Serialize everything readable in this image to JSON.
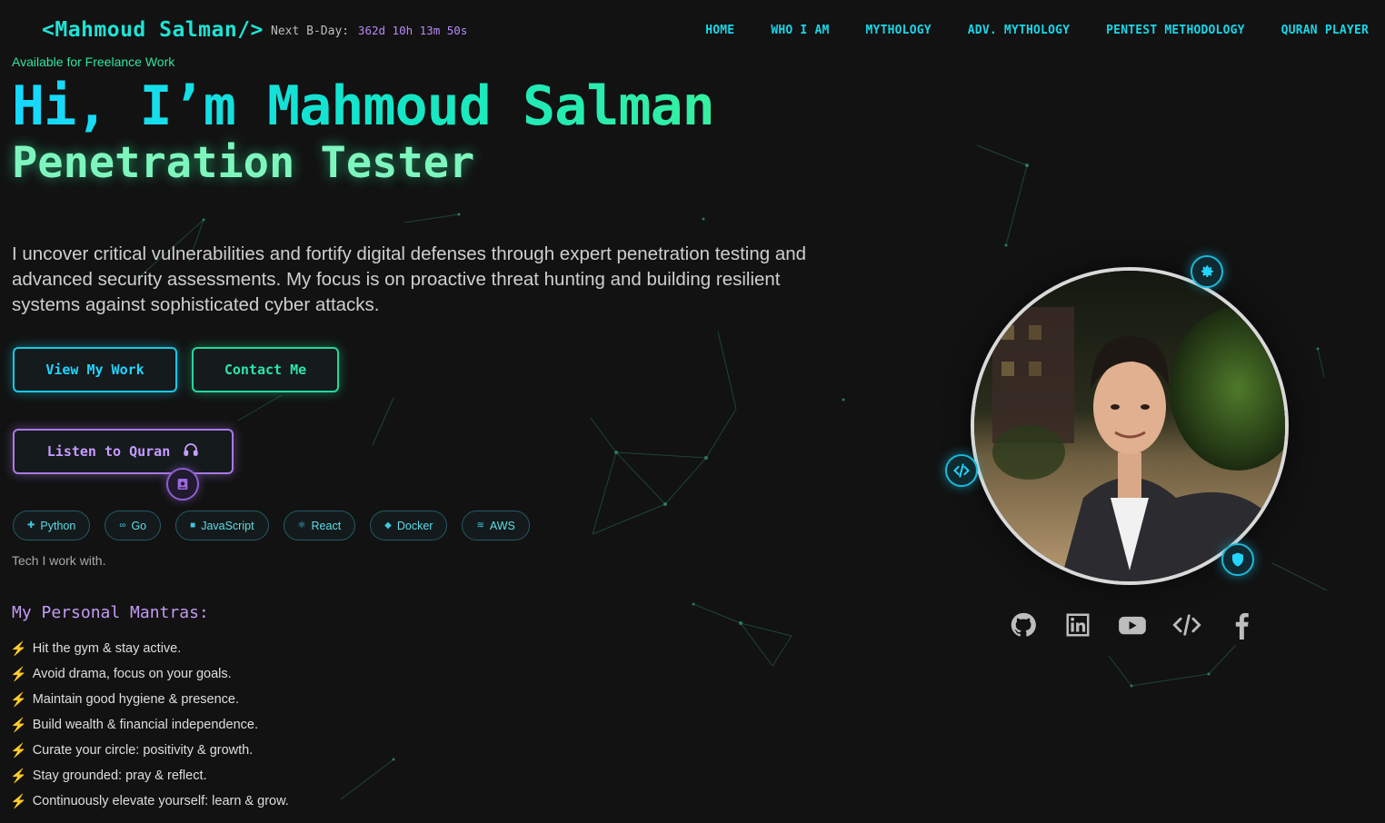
{
  "header": {
    "logo": "<Mahmoud Salman/>",
    "bday_label": "Next B-Day:",
    "bday_countdown": "362d 10h 13m 50s",
    "nav": [
      "HOME",
      "WHO I AM",
      "MYTHOLOGY",
      "ADV. MYTHOLOGY",
      "PENTEST METHODOLOGY",
      "QURAN PLAYER"
    ]
  },
  "hero": {
    "availability": "Available for Freelance Work",
    "title": "Hi, I’m Mahmoud Salman",
    "role": "Penetration Tester",
    "intro": "I uncover critical vulnerabilities and fortify digital defenses through expert penetration testing and advanced security assessments. My focus is on proactive threat hunting and building resilient systems against sophisticated cyber attacks.",
    "buttons": {
      "view_work": "View My Work",
      "contact": "Contact Me",
      "quran": "Listen to Quran"
    }
  },
  "tech": {
    "tags": [
      "Python",
      "Go",
      "JavaScript",
      "React",
      "Docker",
      "AWS"
    ],
    "note": "Tech I work with."
  },
  "mantras": {
    "title": "My Personal Mantras:",
    "items": [
      "Hit the gym & stay active.",
      "Avoid drama, focus on your goals.",
      "Maintain good hygiene & presence.",
      "Build wealth & financial independence.",
      "Curate your circle: positivity & growth.",
      "Stay grounded: pray & reflect.",
      "Continuously elevate yourself: learn & grow."
    ]
  },
  "socials": [
    "github-icon",
    "linkedin-icon",
    "youtube-icon",
    "code-icon",
    "facebook-icon"
  ],
  "colors": {
    "background": "#121212",
    "cyan": "#19d6e8",
    "green": "#2ee6a0",
    "purple": "#c49cf5",
    "bolt": "#f5c518"
  }
}
